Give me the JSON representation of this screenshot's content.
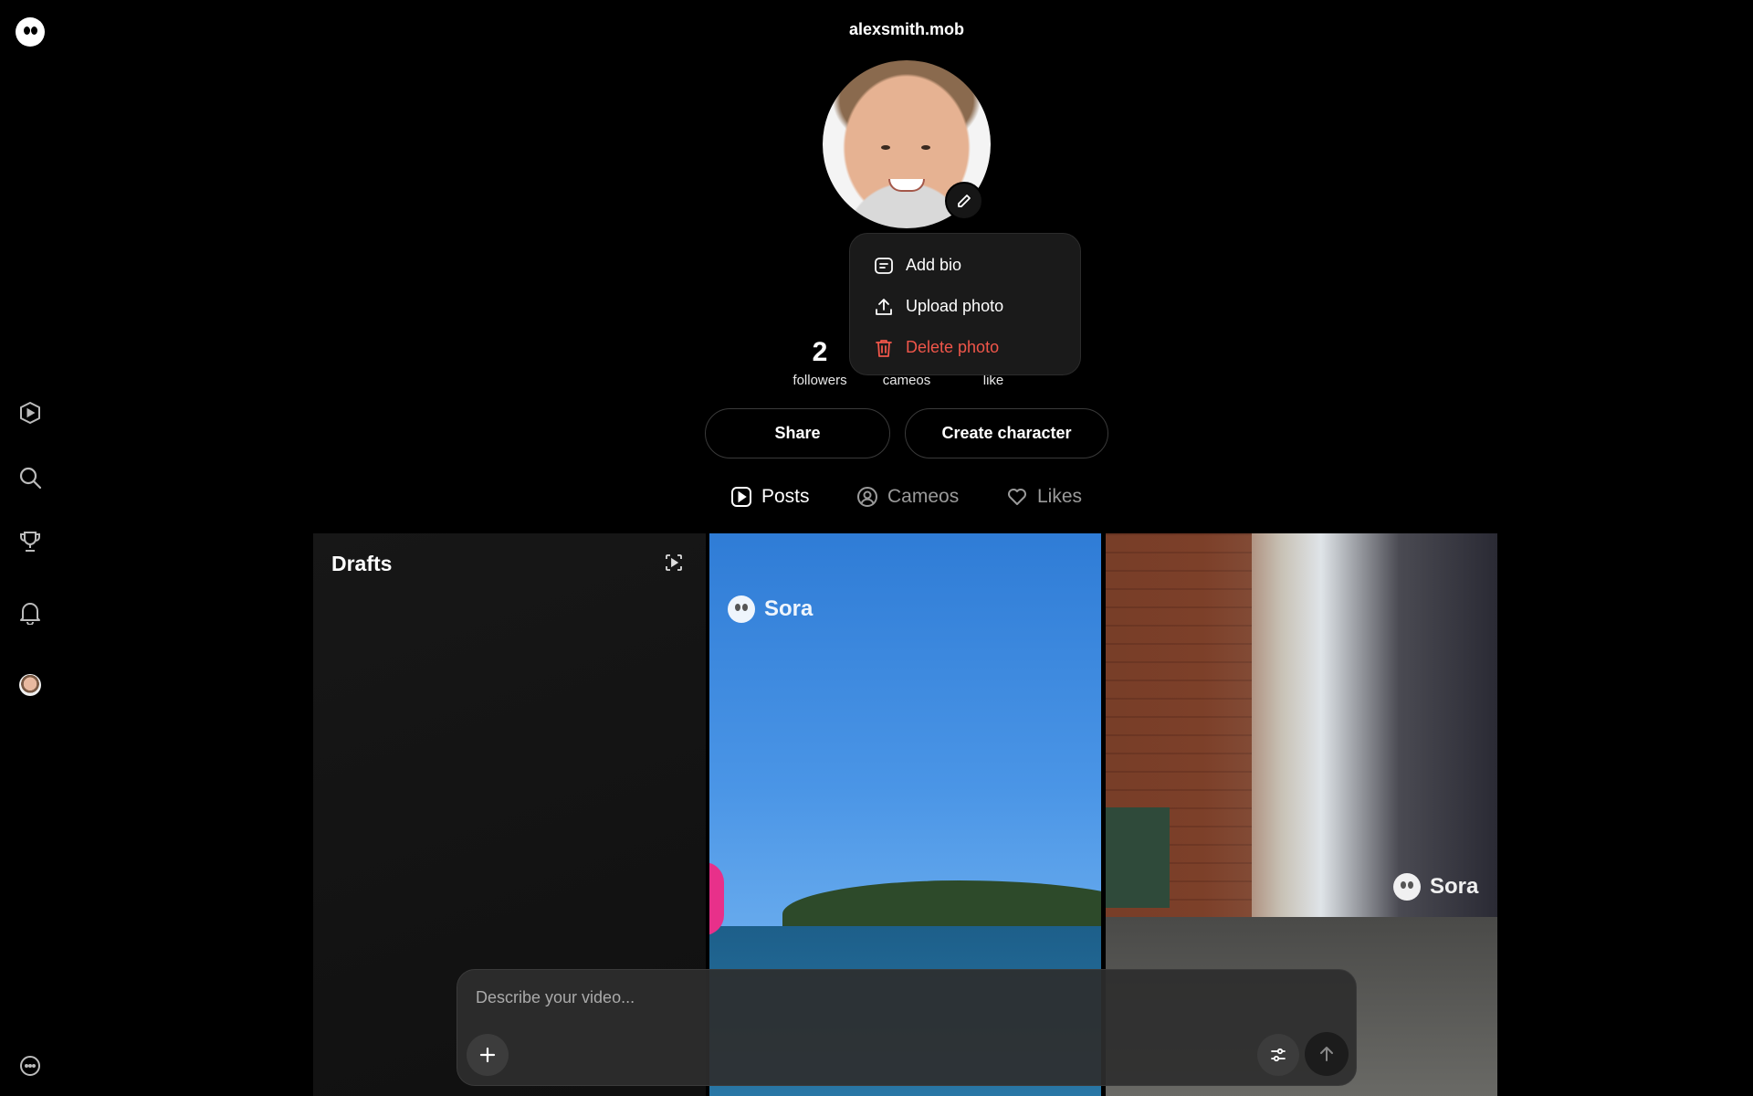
{
  "profile": {
    "username": "alexsmith.mob"
  },
  "avatar_menu": {
    "add_bio": "Add bio",
    "upload_photo": "Upload photo",
    "delete_photo": "Delete photo"
  },
  "stats": {
    "followers": {
      "value": "2",
      "label": "followers"
    },
    "cameos": {
      "label": "cameos"
    },
    "likes": {
      "label": "like"
    }
  },
  "actions": {
    "share": "Share",
    "create_character": "Create character"
  },
  "tabs": [
    {
      "label": "Posts",
      "icon": "play-square-icon",
      "active": true
    },
    {
      "label": "Cameos",
      "icon": "person-circle-icon",
      "active": false
    },
    {
      "label": "Likes",
      "icon": "heart-icon",
      "active": false
    }
  ],
  "grid": {
    "drafts_title": "Drafts",
    "watermark": "Sora"
  },
  "composer": {
    "placeholder": "Describe your video..."
  },
  "colors": {
    "background": "#000000",
    "danger": "#f0564a",
    "panel": "#1a1a1a"
  }
}
